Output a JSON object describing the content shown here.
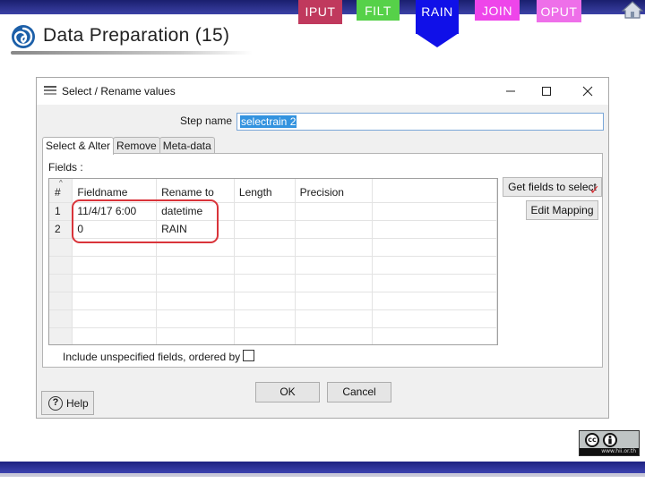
{
  "slide": {
    "title": "Data Preparation (15)",
    "nav_tabs": [
      "IPUT",
      "FILT",
      "RAIN",
      "JOIN",
      "OPUT"
    ],
    "active_tab": "RAIN",
    "colors": {
      "iput": "#c0395d",
      "filt": "#56d149",
      "rain": "#1010e8",
      "join": "#ee45ea",
      "oput": "#ee6fe9",
      "bar": "#1a1f6e"
    },
    "license": {
      "badge": "cc",
      "url": "www.hii.or.th"
    }
  },
  "dialog": {
    "title": "Select / Rename values",
    "step_name_label": "Step name",
    "step_name_value": "selectrain 2",
    "tabs": [
      "Select & Alter",
      "Remove",
      "Meta-data"
    ],
    "active_tab": "Select & Alter",
    "fields_label": "Fields :",
    "columns": [
      "#",
      "Fieldname",
      "Rename to",
      "Length",
      "Precision"
    ],
    "rows": [
      {
        "num": "1",
        "fieldname": "11/4/17 6:00",
        "rename": "datetime",
        "length": "",
        "precision": ""
      },
      {
        "num": "2",
        "fieldname": "0",
        "rename": "RAIN",
        "length": "",
        "precision": ""
      }
    ],
    "get_fields_label": "Get fields to select",
    "edit_mapping_label": "Edit Mapping",
    "include_label": "Include unspecified fields, ordered by",
    "include_checked": false,
    "ok_label": "OK",
    "cancel_label": "Cancel",
    "help_label": "Help"
  }
}
